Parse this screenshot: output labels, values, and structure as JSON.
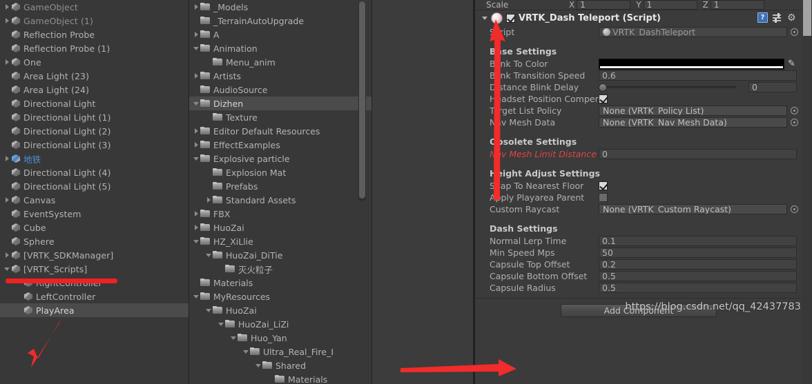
{
  "app": "Unity Editor",
  "hierarchy": {
    "items": [
      {
        "label": "GameObject",
        "indent": 1,
        "twisty": "right",
        "icon": "cube-icon",
        "dim": true
      },
      {
        "label": "GameObject (1)",
        "indent": 1,
        "twisty": "right",
        "icon": "cube-icon",
        "dim": true
      },
      {
        "label": "Reflection Probe",
        "indent": 1,
        "twisty": "none",
        "icon": "cube-icon",
        "dim": false
      },
      {
        "label": "Reflection Probe (1)",
        "indent": 1,
        "twisty": "none",
        "icon": "cube-icon",
        "dim": false
      },
      {
        "label": "One",
        "indent": 1,
        "twisty": "right",
        "icon": "cube-icon",
        "dim": false
      },
      {
        "label": "Area Light (23)",
        "indent": 1,
        "twisty": "none",
        "icon": "cube-icon",
        "dim": false
      },
      {
        "label": "Area Light (24)",
        "indent": 1,
        "twisty": "none",
        "icon": "cube-icon",
        "dim": false
      },
      {
        "label": "Directional Light",
        "indent": 1,
        "twisty": "none",
        "icon": "cube-icon",
        "dim": false
      },
      {
        "label": "Directional Light (1)",
        "indent": 1,
        "twisty": "none",
        "icon": "cube-icon",
        "dim": false
      },
      {
        "label": "Directional Light (2)",
        "indent": 1,
        "twisty": "none",
        "icon": "cube-icon",
        "dim": false
      },
      {
        "label": "Directional Light (3)",
        "indent": 1,
        "twisty": "none",
        "icon": "cube-icon",
        "dim": false
      },
      {
        "label": "地铁",
        "indent": 1,
        "twisty": "right",
        "icon": "prefab-icon",
        "blue": true
      },
      {
        "label": "Directional Light (4)",
        "indent": 1,
        "twisty": "none",
        "icon": "cube-icon",
        "dim": false
      },
      {
        "label": "Directional Light (5)",
        "indent": 1,
        "twisty": "none",
        "icon": "cube-icon",
        "dim": false
      },
      {
        "label": "Canvas",
        "indent": 1,
        "twisty": "right",
        "icon": "cube-icon",
        "dim": false
      },
      {
        "label": "EventSystem",
        "indent": 1,
        "twisty": "none",
        "icon": "cube-icon",
        "dim": false
      },
      {
        "label": "Cube",
        "indent": 1,
        "twisty": "none",
        "icon": "cube-icon",
        "dim": false
      },
      {
        "label": "Sphere",
        "indent": 1,
        "twisty": "none",
        "icon": "cube-icon",
        "dim": false
      },
      {
        "label": "[VRTK_SDKManager]",
        "indent": 1,
        "twisty": "right",
        "icon": "cube-icon",
        "dim": false
      },
      {
        "label": "[VRTK_Scripts]",
        "indent": 1,
        "twisty": "down",
        "icon": "cube-icon",
        "dim": false
      },
      {
        "label": "RightController",
        "indent": 2,
        "twisty": "none",
        "icon": "cube-icon",
        "dim": false
      },
      {
        "label": "LeftController",
        "indent": 2,
        "twisty": "none",
        "icon": "cube-icon",
        "dim": false
      },
      {
        "label": "PlayArea",
        "indent": 2,
        "twisty": "none",
        "icon": "cube-icon",
        "selected": true
      }
    ]
  },
  "project": {
    "items": [
      {
        "label": "_Models",
        "indent": 1,
        "twisty": "right"
      },
      {
        "label": "_TerrainAutoUpgrade",
        "indent": 1,
        "twisty": "none"
      },
      {
        "label": "A",
        "indent": 1,
        "twisty": "right"
      },
      {
        "label": "Animation",
        "indent": 1,
        "twisty": "down"
      },
      {
        "label": "Menu_anim",
        "indent": 2,
        "twisty": "none"
      },
      {
        "label": "Artists",
        "indent": 1,
        "twisty": "right"
      },
      {
        "label": "AudioSource",
        "indent": 1,
        "twisty": "none"
      },
      {
        "label": "Dizhen",
        "indent": 1,
        "twisty": "down",
        "selected": true
      },
      {
        "label": "Texture",
        "indent": 2,
        "twisty": "none"
      },
      {
        "label": "Editor Default Resources",
        "indent": 1,
        "twisty": "right"
      },
      {
        "label": "EffectExamples",
        "indent": 1,
        "twisty": "right"
      },
      {
        "label": "Explosive particle",
        "indent": 1,
        "twisty": "down"
      },
      {
        "label": "Explosion Mat",
        "indent": 2,
        "twisty": "none"
      },
      {
        "label": "Prefabs",
        "indent": 2,
        "twisty": "none"
      },
      {
        "label": "Standard Assets",
        "indent": 2,
        "twisty": "right"
      },
      {
        "label": "FBX",
        "indent": 1,
        "twisty": "right"
      },
      {
        "label": "HuoZai",
        "indent": 1,
        "twisty": "right"
      },
      {
        "label": "HZ_XiLlie",
        "indent": 1,
        "twisty": "down"
      },
      {
        "label": "HuoZai_DiTie",
        "indent": 2,
        "twisty": "down"
      },
      {
        "label": "灭火粒子",
        "indent": 3,
        "twisty": "none"
      },
      {
        "label": "Materials",
        "indent": 1,
        "twisty": "none"
      },
      {
        "label": "MyResources",
        "indent": 1,
        "twisty": "down"
      },
      {
        "label": "HuoZai",
        "indent": 2,
        "twisty": "down"
      },
      {
        "label": "HuoZai_LiZi",
        "indent": 3,
        "twisty": "down"
      },
      {
        "label": "Huo_Yan",
        "indent": 4,
        "twisty": "down"
      },
      {
        "label": "Ultra_Real_Fire_I",
        "indent": 5,
        "twisty": "down"
      },
      {
        "label": "Shared",
        "indent": 6,
        "twisty": "down"
      },
      {
        "label": "Materials",
        "indent": 7,
        "twisty": "none"
      }
    ]
  },
  "inspector": {
    "transform": {
      "scale_label": "Scale",
      "x_axis": "X",
      "x_value": "1",
      "y_axis": "Y",
      "y_value": "1",
      "z_axis": "Z",
      "z_value": "1"
    },
    "component": {
      "title": "VRTK_Dash Teleport (Script)",
      "enabled": true,
      "help_glyph": "?",
      "script_label": "Script",
      "script_value": "VRTK_DashTeleport"
    },
    "sections": [
      {
        "title": "Base Settings",
        "rows": [
          {
            "label": "Blink To Color",
            "kind": "color",
            "value": "#000000"
          },
          {
            "label": "Blink Transition Speed",
            "kind": "text",
            "value": "0.6"
          },
          {
            "label": "Distance Blink Delay",
            "kind": "slider",
            "value": "0",
            "pos": 0
          },
          {
            "label": "Headset Position Compensation",
            "kind": "check",
            "value": true
          },
          {
            "label": "Target List Policy",
            "kind": "object",
            "value": "None (VRTK_Policy List)"
          },
          {
            "label": "Nav Mesh Data",
            "kind": "object",
            "value": "None (VRTK_Nav Mesh Data)"
          }
        ]
      },
      {
        "title": "Obsolete Settings",
        "rows": [
          {
            "label": "Nav Mesh Limit Distance",
            "kind": "text",
            "value": "0",
            "obsolete": true
          }
        ]
      },
      {
        "title": "Height Adjust Settings",
        "rows": [
          {
            "label": "Snap To Nearest Floor",
            "kind": "check",
            "value": true
          },
          {
            "label": "Apply Playarea Parent",
            "kind": "check",
            "value": false
          },
          {
            "label": "Custom Raycast",
            "kind": "object",
            "value": "None (VRTK_Custom Raycast)"
          }
        ]
      },
      {
        "title": "Dash Settings",
        "rows": [
          {
            "label": "Normal Lerp Time",
            "kind": "text",
            "value": "0.1"
          },
          {
            "label": "Min Speed Mps",
            "kind": "text",
            "value": "50"
          },
          {
            "label": "Capsule Top Offset",
            "kind": "text",
            "value": "0.2"
          },
          {
            "label": "Capsule Bottom Offset",
            "kind": "text",
            "value": "0.5"
          },
          {
            "label": "Capsule Radius",
            "kind": "text",
            "value": "0.5"
          }
        ]
      }
    ],
    "add_component_label": "Add Component",
    "watermark": "https://blog.csdn.net/qq_42437783"
  },
  "colors": {
    "panel_bg": "#383838",
    "inspector_bg": "#3b3b3b",
    "selection": "#4b4b4b",
    "annotation_red": "#f22b2b",
    "obsolete_red": "#e04343",
    "prefab_blue": "#4f8fd9"
  }
}
